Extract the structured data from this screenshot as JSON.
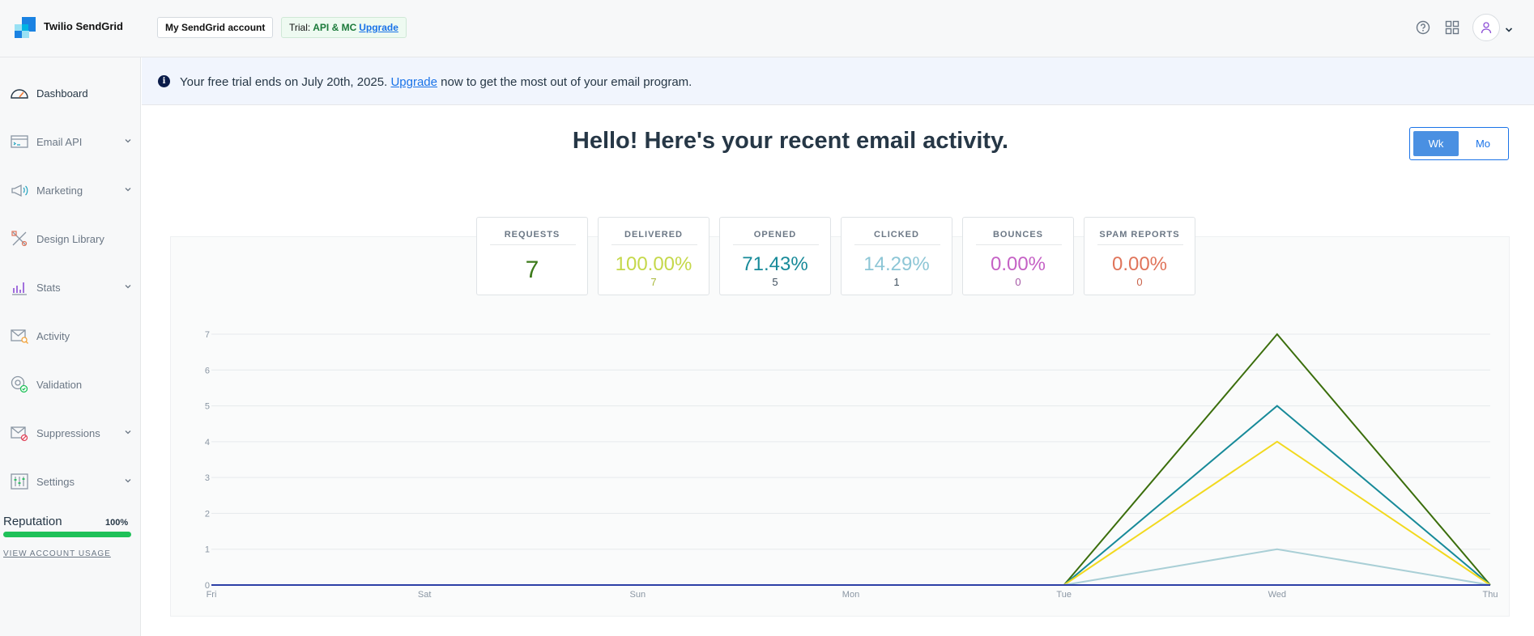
{
  "app": {
    "brand": "Twilio SendGrid",
    "account_button": "My SendGrid account",
    "trial": {
      "prefix": "Trial:",
      "plan": "API & MC",
      "upgrade": "Upgrade"
    },
    "icons": {
      "help": "help-circle-icon",
      "apps": "apps-grid-icon",
      "user": "user-icon",
      "caret": "chevron-down-icon"
    }
  },
  "sidebar": {
    "items": [
      {
        "label": "Dashboard",
        "icon": "gauge-icon",
        "active": true,
        "expandable": false
      },
      {
        "label": "Email API",
        "icon": "email-api-icon",
        "active": false,
        "expandable": true
      },
      {
        "label": "Marketing",
        "icon": "megaphone-icon",
        "active": false,
        "expandable": true
      },
      {
        "label": "Design Library",
        "icon": "design-tools-icon",
        "active": false,
        "expandable": false
      },
      {
        "label": "Stats",
        "icon": "stats-chart-icon",
        "active": false,
        "expandable": true
      },
      {
        "label": "Activity",
        "icon": "activity-search-icon",
        "active": false,
        "expandable": false
      },
      {
        "label": "Validation",
        "icon": "validation-at-icon",
        "active": false,
        "expandable": false
      },
      {
        "label": "Suppressions",
        "icon": "suppression-icon",
        "active": false,
        "expandable": true
      },
      {
        "label": "Settings",
        "icon": "settings-sliders-icon",
        "active": false,
        "expandable": true
      }
    ],
    "reputation": {
      "label": "Reputation",
      "value": "100%",
      "fraction": 1.0,
      "link": "VIEW ACCOUNT USAGE"
    }
  },
  "banner": {
    "before": "Your free trial ends on July 20th, 2025. ",
    "link": "Upgrade",
    "after": " now to get the most out of your email program."
  },
  "main": {
    "headline": "Hello! Here's your recent email activity.",
    "period_toggle": {
      "options": [
        "Wk",
        "Mo"
      ],
      "selected": "Wk"
    },
    "stats": [
      {
        "title": "REQUESTS",
        "value": "7",
        "count": "",
        "color": "#3d7b1b"
      },
      {
        "title": "DELIVERED",
        "value": "100.00%",
        "count": "7",
        "color": "#c5d84a"
      },
      {
        "title": "OPENED",
        "value": "71.43%",
        "count": "5",
        "color": "#178a99"
      },
      {
        "title": "CLICKED",
        "value": "14.29%",
        "count": "1",
        "color": "#8dc6d6"
      },
      {
        "title": "BOUNCES",
        "value": "0.00%",
        "count": "0",
        "color": "#c561c5"
      },
      {
        "title": "SPAM REPORTS",
        "value": "0.00%",
        "count": "0",
        "color": "#e0745a"
      }
    ]
  },
  "chart_data": {
    "type": "line",
    "categories": [
      "Fri",
      "Sat",
      "Sun",
      "Mon",
      "Tue",
      "Wed",
      "Thu"
    ],
    "ylim": [
      0,
      7
    ],
    "yticks": [
      0,
      1,
      2,
      3,
      4,
      5,
      6,
      7
    ],
    "grid": true,
    "series": [
      {
        "key": "requests",
        "values": [
          0,
          0,
          0,
          0,
          0,
          7,
          0
        ],
        "color": "#3b6e0c"
      },
      {
        "key": "opened",
        "values": [
          0,
          0,
          0,
          0,
          0,
          5,
          0
        ],
        "color": "#178a99"
      },
      {
        "key": "delivered",
        "values": [
          0,
          0,
          0,
          0,
          0,
          4,
          0
        ],
        "color": "#f2d91f"
      },
      {
        "key": "clicked",
        "values": [
          0,
          0,
          0,
          0,
          0,
          1,
          0
        ],
        "color": "#a9cfd6"
      },
      {
        "key": "bounces",
        "values": [
          0,
          0,
          0,
          0,
          0,
          0,
          0
        ],
        "color": "#c561c5"
      },
      {
        "key": "spam",
        "values": [
          0,
          0,
          0,
          0,
          0,
          0,
          0
        ],
        "color": "#2c3fa6"
      }
    ]
  }
}
